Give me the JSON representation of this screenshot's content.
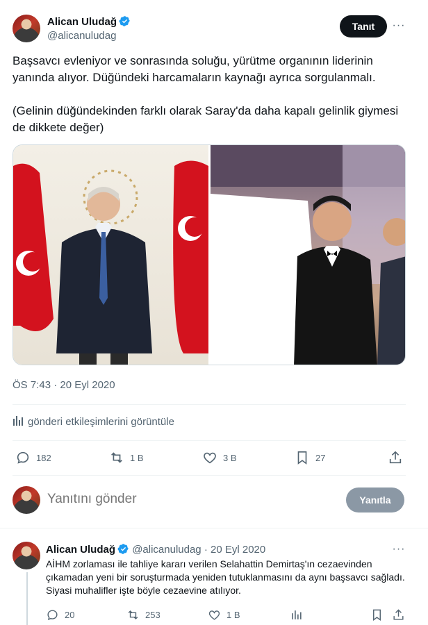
{
  "author": {
    "name": "Alican Uludağ",
    "handle": "@alicanuludag",
    "verified": true
  },
  "header": {
    "follow_label": "Tanıt",
    "more_label": "···"
  },
  "tweet": {
    "paragraphs": [
      "Başsavcı evleniyor ve sonrasında soluğu, yürütme organının liderinin yanında alıyor. Düğündeki harcamaların kaynağı ayrıca sorgulanmalı.",
      "(Gelinin düğündekinden farklı olarak Saray'da daha kapalı gelinlik giymesi de dikkete değer)"
    ],
    "timestamp": "ÖS 7:43 · 20 Eyl 2020",
    "analytics_label": "gönderi etkileşimlerini görüntüle",
    "stats": {
      "replies": "182",
      "retweets": "1 B",
      "likes": "3 B",
      "bookmarks": "27"
    }
  },
  "reply_box": {
    "placeholder": "Yanıtını gönder",
    "button_label": "Yanıtla"
  },
  "reply_tweet": {
    "name": "Alican Uludağ",
    "handle": "@alicanuludag",
    "separator": "·",
    "date": "20 Eyl 2020",
    "text": "AİHM zorlaması ile tahliye kararı verilen Selahattin Demirtaş'ın cezaevinden çıkamadan yeni bir soruşturmada yeniden tutuklanmasını da aynı başsavcı sağladı. Siyasi muhalifler işte böyle cezaevine atılıyor.",
    "stats": {
      "replies": "20",
      "retweets": "253",
      "likes": "1 B"
    }
  },
  "colors": {
    "accent": "#1d9bf0",
    "text": "#0f1419",
    "muted": "#536471"
  }
}
